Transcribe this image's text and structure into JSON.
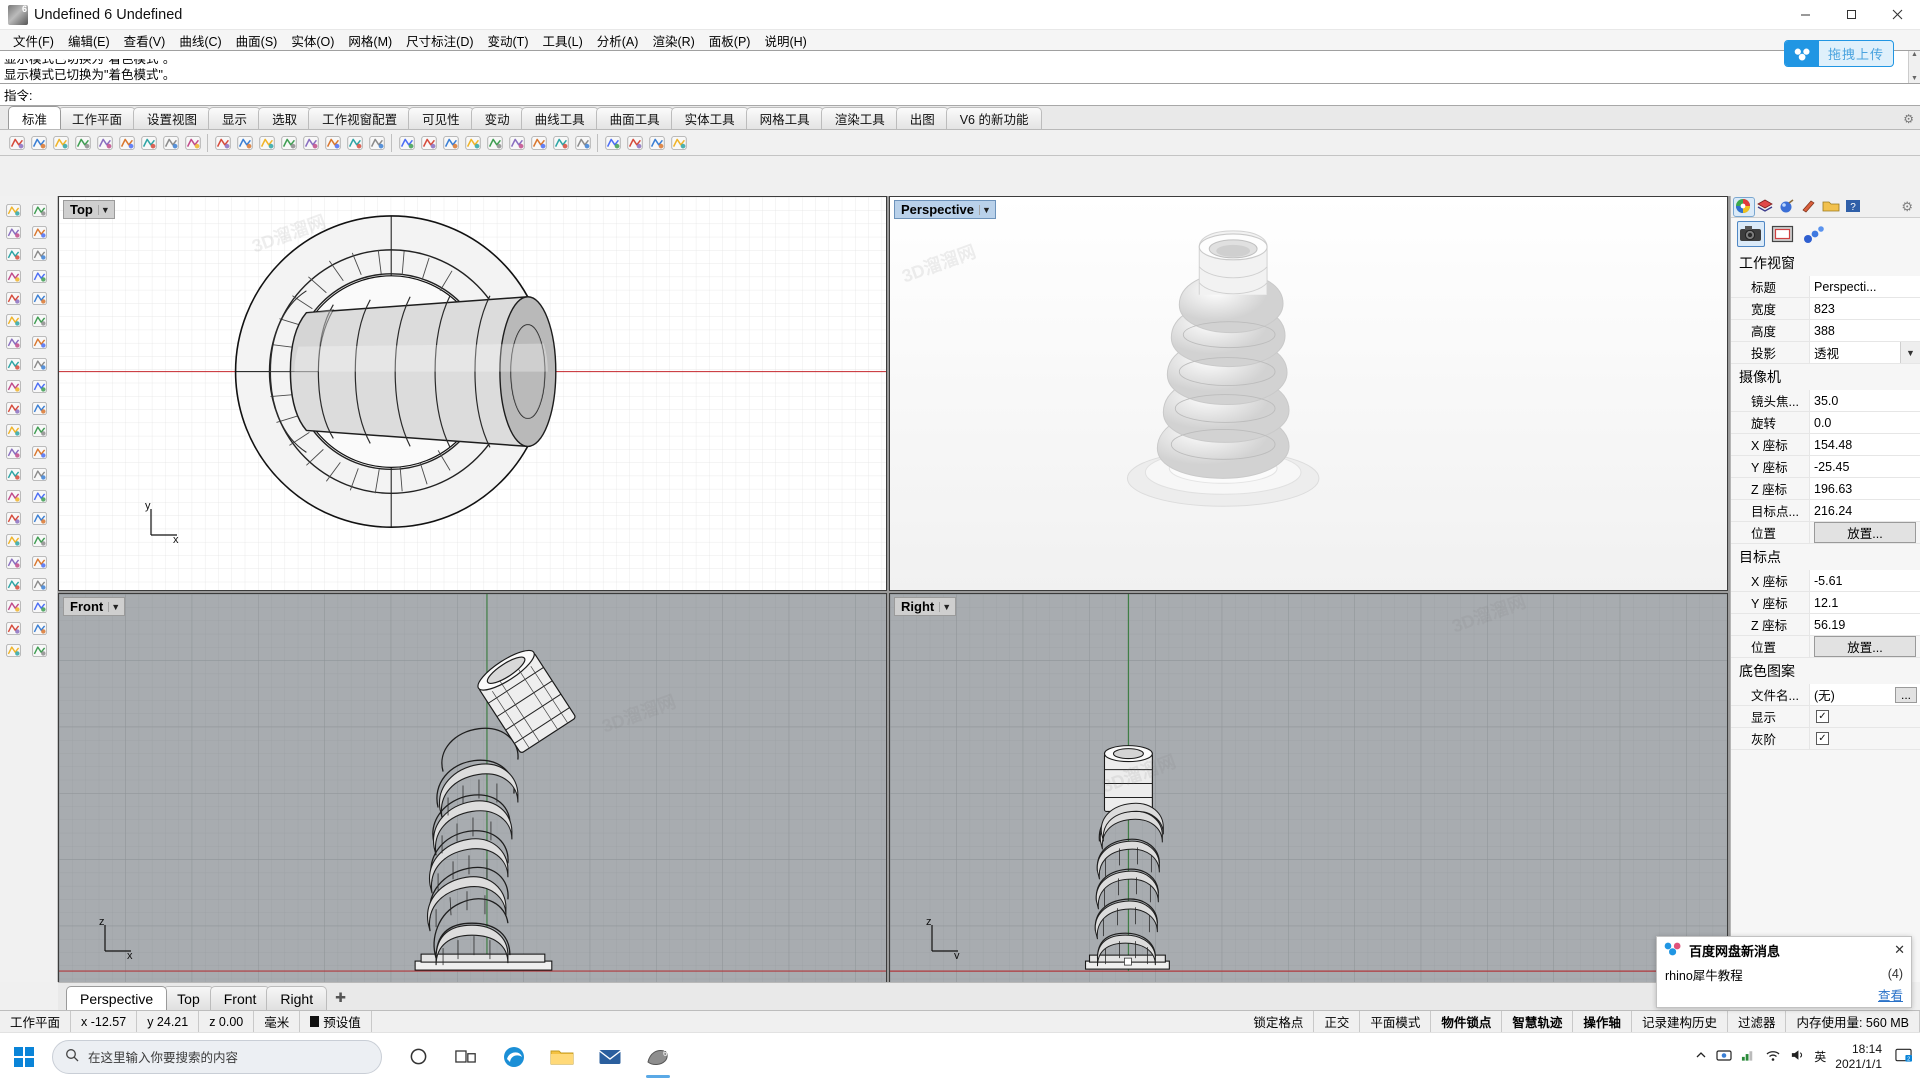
{
  "window": {
    "title": "Undefined 6 Undefined",
    "app_icon": "rhino-logo-icon",
    "minimize": "─",
    "maximize": "☐",
    "close": "✕"
  },
  "menubar": {
    "items": [
      {
        "label": "文件(F)",
        "name": "menu-file"
      },
      {
        "label": "编辑(E)",
        "name": "menu-edit"
      },
      {
        "label": "查看(V)",
        "name": "menu-view"
      },
      {
        "label": "曲线(C)",
        "name": "menu-curve"
      },
      {
        "label": "曲面(S)",
        "name": "menu-surface"
      },
      {
        "label": "实体(O)",
        "name": "menu-solid"
      },
      {
        "label": "网格(M)",
        "name": "menu-mesh"
      },
      {
        "label": "尺寸标注(D)",
        "name": "menu-dimension"
      },
      {
        "label": "变动(T)",
        "name": "menu-transform"
      },
      {
        "label": "工具(L)",
        "name": "menu-tools"
      },
      {
        "label": "分析(A)",
        "name": "menu-analyze"
      },
      {
        "label": "渲染(R)",
        "name": "menu-render"
      },
      {
        "label": "面板(P)",
        "name": "menu-panels"
      },
      {
        "label": "说明(H)",
        "name": "menu-help"
      }
    ]
  },
  "command_area": {
    "history_line_1": "显示模式已切换为\"着色模式\"。",
    "history_line_2": "显示模式已切换为\"着色模式\"。",
    "prompt_label": "指令:",
    "prompt_value": ""
  },
  "upload_pill": {
    "label": "拖拽上传",
    "icon": "baidu-netdisk-icon",
    "accent": "#2196e3"
  },
  "toolbar_tabs": {
    "items": [
      {
        "label": "标准",
        "name": "tab-standard",
        "active": true
      },
      {
        "label": "工作平面",
        "name": "tab-cplane",
        "active": false
      },
      {
        "label": "设置视图",
        "name": "tab-set-view",
        "active": false
      },
      {
        "label": "显示",
        "name": "tab-display",
        "active": false
      },
      {
        "label": "选取",
        "name": "tab-select",
        "active": false
      },
      {
        "label": "工作视窗配置",
        "name": "tab-viewport-layout",
        "active": false
      },
      {
        "label": "可见性",
        "name": "tab-visibility",
        "active": false
      },
      {
        "label": "变动",
        "name": "tab-transform",
        "active": false
      },
      {
        "label": "曲线工具",
        "name": "tab-curve-tools",
        "active": false
      },
      {
        "label": "曲面工具",
        "name": "tab-surface-tools",
        "active": false
      },
      {
        "label": "实体工具",
        "name": "tab-solid-tools",
        "active": false
      },
      {
        "label": "网格工具",
        "name": "tab-mesh-tools",
        "active": false
      },
      {
        "label": "渲染工具",
        "name": "tab-render-tools",
        "active": false
      },
      {
        "label": "出图",
        "name": "tab-drafting",
        "active": false
      },
      {
        "label": "V6 的新功能",
        "name": "tab-whats-new-v6",
        "active": false
      }
    ],
    "gear_icon": "gear-icon"
  },
  "icon_toolbar": {
    "icons": [
      "new-file-icon",
      "open-file-icon",
      "save-icon",
      "print-icon",
      "cut-icon",
      "copy-icon",
      "paste-icon",
      "undo-icon",
      "redo-icon",
      "sep",
      "delete-icon",
      "duplicate-icon",
      "zoom-extents-icon",
      "zoom-window-icon",
      "pan-icon",
      "rotate-view-icon",
      "grid-snap-icon",
      "layer-icon",
      "sep",
      "hide-objects-icon",
      "show-objects-icon",
      "lock-objects-icon",
      "unlock-objects-icon",
      "render-color-icon",
      "shaded-view-icon",
      "rendered-view-icon",
      "ghosted-view-icon",
      "xray-view-icon",
      "sep",
      "light-icon",
      "render-icon",
      "globe-icon",
      "help-icon"
    ]
  },
  "left_palette": {
    "icons": [
      "select-arrow-icon",
      "select-points-icon",
      "point-icon",
      "point-cloud-icon",
      "line-icon",
      "polyline-icon",
      "arc-icon",
      "circle-icon",
      "curve-icon",
      "rectangle-icon",
      "ellipse-icon",
      "polygon-icon",
      "free-curve-icon",
      "conic-icon",
      "surface-plane-icon",
      "surface-edge-icon",
      "loft-icon",
      "sweep-icon",
      "box-icon",
      "sphere-icon",
      "cylinder-icon",
      "cone-icon",
      "boolean-union-icon",
      "boolean-diff-icon",
      "fillet-icon",
      "chamfer-icon",
      "trim-icon",
      "split-icon",
      "offset-icon",
      "array-icon",
      "move-icon",
      "rotate-icon",
      "scale-icon",
      "mirror-icon",
      "mesh-icon",
      "mesh-tools-icon",
      "dimension-icon",
      "text-icon",
      "hatch-icon",
      "annotate-icon",
      "layout-icon",
      "analyze-icon"
    ]
  },
  "viewports": [
    {
      "name": "viewport-top",
      "title": "Top",
      "projection": "parallel",
      "background": "#ffffff",
      "axis_label_x": "x",
      "axis_label_y": "y"
    },
    {
      "name": "viewport-perspective",
      "title": "Perspective",
      "projection": "perspective",
      "background": "#ffffff",
      "active": true
    },
    {
      "name": "viewport-front",
      "title": "Front",
      "projection": "parallel",
      "background": "#a8acb0",
      "axis_label_x": "x",
      "axis_label_z": "z"
    },
    {
      "name": "viewport-right",
      "title": "Right",
      "projection": "parallel",
      "background": "#a8acb0",
      "axis_label_y": "y",
      "axis_label_z": "z"
    }
  ],
  "viewport_tabs": {
    "items": [
      {
        "label": "Perspective",
        "name": "vtab-perspective",
        "active": true
      },
      {
        "label": "Top",
        "name": "vtab-top",
        "active": false
      },
      {
        "label": "Front",
        "name": "vtab-front",
        "active": false
      },
      {
        "label": "Right",
        "name": "vtab-right",
        "active": false
      }
    ],
    "add_label": "✚"
  },
  "properties_panel": {
    "tab_icons": [
      "properties-color-icon",
      "layers-icon",
      "material-icon",
      "render-props-icon",
      "file-browser-icon",
      "help-panel-icon"
    ],
    "gear_icon": "gear-icon",
    "mode_buttons": [
      "camera-icon",
      "viewport-frame-icon",
      "object-props-icon"
    ],
    "sections": [
      {
        "name": "viewport",
        "title": "工作视窗",
        "rows": [
          {
            "key": "标题",
            "value": "Perspecti...",
            "type": "text"
          },
          {
            "key": "宽度",
            "value": "823",
            "type": "text"
          },
          {
            "key": "高度",
            "value": "388",
            "type": "text"
          },
          {
            "key": "投影",
            "value": "透视",
            "type": "combo"
          }
        ]
      },
      {
        "name": "camera",
        "title": "摄像机",
        "rows": [
          {
            "key": "镜头焦...",
            "value": "35.0",
            "type": "text"
          },
          {
            "key": "旋转",
            "value": "0.0",
            "type": "text"
          },
          {
            "key": "X 座标",
            "value": "154.48",
            "type": "text"
          },
          {
            "key": "Y 座标",
            "value": "-25.45",
            "type": "text"
          },
          {
            "key": "Z 座标",
            "value": "196.63",
            "type": "text"
          },
          {
            "key": "目标点...",
            "value": "216.24",
            "type": "text"
          },
          {
            "key": "位置",
            "value": "放置...",
            "type": "button"
          }
        ]
      },
      {
        "name": "target",
        "title": "目标点",
        "rows": [
          {
            "key": "X 座标",
            "value": "-5.61",
            "type": "text"
          },
          {
            "key": "Y 座标",
            "value": "12.1",
            "type": "text"
          },
          {
            "key": "Z 座标",
            "value": "56.19",
            "type": "text"
          },
          {
            "key": "位置",
            "value": "放置...",
            "type": "button"
          }
        ]
      },
      {
        "name": "wallpaper",
        "title": "底色图案",
        "rows": [
          {
            "key": "文件名...",
            "value": "(无)",
            "type": "dots"
          },
          {
            "key": "显示",
            "value": "✓",
            "type": "check"
          },
          {
            "key": "灰阶",
            "value": "✓",
            "type": "check"
          }
        ]
      }
    ]
  },
  "statusbar": {
    "cplane_label": "工作平面",
    "coord_x": "x -12.57",
    "coord_y": "y 24.21",
    "coord_z": "z 0.00",
    "units": "毫米",
    "layer": "预设值",
    "layer_color": "#111111",
    "toggles": [
      {
        "label": "锁定格点",
        "name": "status-grid-snap",
        "bold": false
      },
      {
        "label": "正交",
        "name": "status-ortho",
        "bold": false
      },
      {
        "label": "平面模式",
        "name": "status-planar",
        "bold": false
      },
      {
        "label": "物件锁点",
        "name": "status-osnap",
        "bold": true
      },
      {
        "label": "智慧轨迹",
        "name": "status-smarttrack",
        "bold": true
      },
      {
        "label": "操作轴",
        "name": "status-gumball",
        "bold": true
      },
      {
        "label": "记录建构历史",
        "name": "status-history",
        "bold": false
      },
      {
        "label": "过滤器",
        "name": "status-filter",
        "bold": false
      },
      {
        "label": "内存使用量: 560 MB",
        "name": "status-memory",
        "bold": false
      }
    ]
  },
  "toast": {
    "icon": "baidu-netdisk-icon",
    "title": "百度网盘新消息",
    "close": "✕",
    "message": "rhino犀牛教程",
    "count": "(4)",
    "action": "查看"
  },
  "taskbar": {
    "start_icon": "windows-start-icon",
    "search_placeholder": "在这里输入你要搜索的内容",
    "search_icon": "search-icon",
    "apps": [
      {
        "name": "cortana-icon",
        "active": false
      },
      {
        "name": "task-view-icon",
        "active": false
      },
      {
        "name": "edge-browser-icon",
        "active": false
      },
      {
        "name": "file-explorer-icon",
        "active": false
      },
      {
        "name": "mail-icon",
        "active": false
      },
      {
        "name": "rhino-icon",
        "active": true
      }
    ],
    "tray_icons": [
      "chevron-up-icon",
      "screenshot-icon",
      "network-status-icon",
      "wifi-icon",
      "volume-icon"
    ],
    "ime_label": "英",
    "time": "18:14",
    "date": "2021/1/1",
    "notification_icon": "action-center-icon"
  },
  "watermark_text": "3D溜溜网 www.3d66.cn"
}
